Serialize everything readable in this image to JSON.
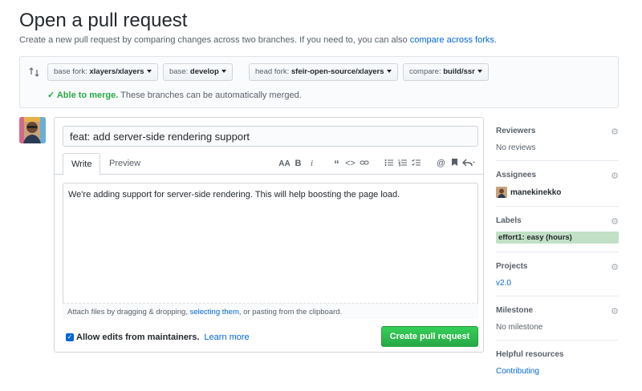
{
  "page": {
    "title": "Open a pull request",
    "subtitle_prefix": "Create a new pull request by comparing changes across two branches. If you need to, you can also ",
    "subtitle_link": "compare across forks",
    "subtitle_suffix": "."
  },
  "range": {
    "base_fork_prefix": "base fork: ",
    "base_fork_value": "xlayers/xlayers",
    "base_prefix": "base: ",
    "base_value": "develop",
    "head_fork_prefix": "head fork: ",
    "head_fork_value": "sfeir-open-source/xlayers",
    "compare_prefix": "compare: ",
    "compare_value": "build/ssr",
    "merge_check": "✓ Able to merge.",
    "merge_text": " These branches can be automatically merged."
  },
  "composer": {
    "title_value": "feat: add server-side rendering support",
    "tabs": [
      "Write",
      "Preview"
    ],
    "body": "We're adding support for server-side rendering. This will help boosting the page load.",
    "attach_prefix": "Attach files by dragging & dropping, ",
    "attach_link": "selecting them",
    "attach_suffix": ", or pasting from the clipboard.",
    "allow_edits_label": "Allow edits from maintainers.",
    "learn_more": "Learn more",
    "submit_label": "Create pull request"
  },
  "sidebar": {
    "reviewers": {
      "heading": "Reviewers",
      "value": "No reviews"
    },
    "assignees": {
      "heading": "Assignees",
      "value": "manekinekko"
    },
    "labels": {
      "heading": "Labels",
      "value": "effort1: easy (hours)",
      "color": "#c2e0c6"
    },
    "projects": {
      "heading": "Projects",
      "value": "v2.0"
    },
    "milestone": {
      "heading": "Milestone",
      "value": "No milestone"
    },
    "helpful": {
      "heading": "Helpful resources",
      "value": "Contributing"
    }
  },
  "colors": {
    "accent": "#0366d6",
    "success": "#28a745",
    "button_green": "#2cbe4e"
  }
}
